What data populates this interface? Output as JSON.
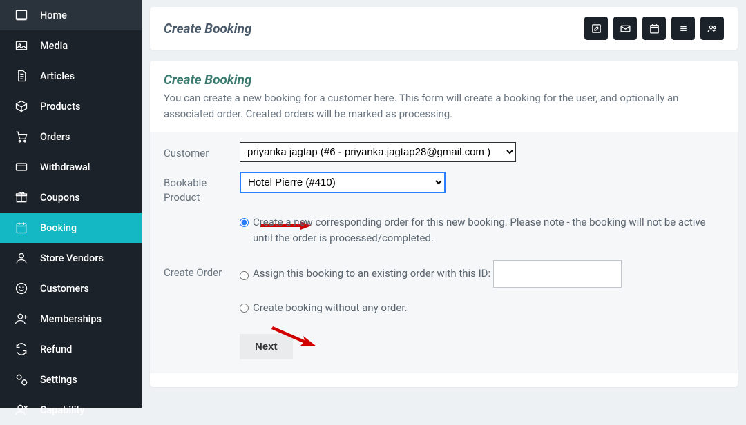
{
  "sidebar": {
    "items": [
      {
        "label": "Home",
        "icon": "home"
      },
      {
        "label": "Media",
        "icon": "image"
      },
      {
        "label": "Articles",
        "icon": "file-text"
      },
      {
        "label": "Products",
        "icon": "box"
      },
      {
        "label": "Orders",
        "icon": "cart"
      },
      {
        "label": "Withdrawal",
        "icon": "card"
      },
      {
        "label": "Coupons",
        "icon": "gift"
      },
      {
        "label": "Booking",
        "icon": "calendar",
        "active": true
      },
      {
        "label": "Store Vendors",
        "icon": "user"
      },
      {
        "label": "Customers",
        "icon": "smile"
      },
      {
        "label": "Memberships",
        "icon": "user-plus"
      },
      {
        "label": "Refund",
        "icon": "refresh"
      },
      {
        "label": "Settings",
        "icon": "gear"
      },
      {
        "label": "Capability",
        "icon": "user-x"
      }
    ]
  },
  "header": {
    "title": "Create Booking",
    "actions": [
      "edit-icon",
      "mail-icon",
      "calendar-icon",
      "list-icon",
      "users-icon"
    ]
  },
  "section": {
    "title": "Create Booking",
    "desc": "You can create a new booking for a customer here. This form will create a booking for the user, and optionally an associated order. Created orders will be marked as processing."
  },
  "form": {
    "customer_label": "Customer",
    "customer_value": "priyanka jagtap (#6 - priyanka.jagtap28@gmail.com )",
    "product_label": "Bookable Product",
    "product_value": "Hotel Pierre (#410)",
    "create_order_label": "Create Order",
    "opt_new_order": "Create a new corresponding order for this new booking. Please note - the booking will not be active until the order is processed/completed.",
    "opt_assign": "Assign this booking to an existing order with this ID:",
    "opt_noorder": "Create booking without any order.",
    "next_label": "Next"
  }
}
